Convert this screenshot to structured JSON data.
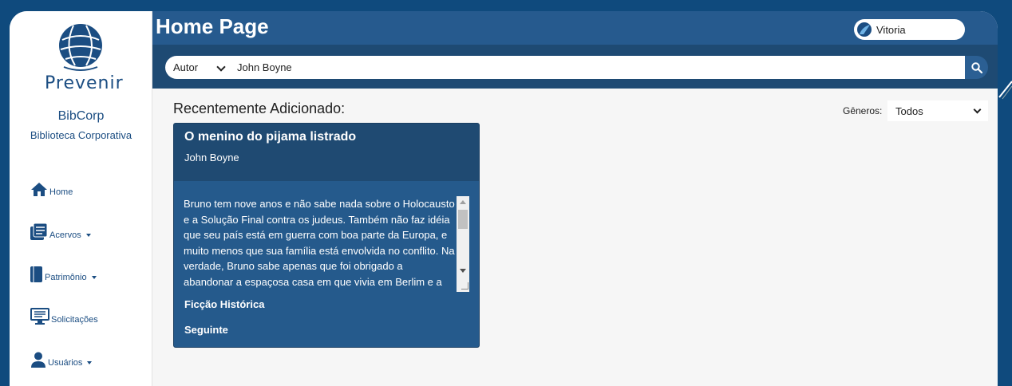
{
  "brand": {
    "logo_text": "Prevenir",
    "org_name": "BibCorp",
    "org_subtitle": "Biblioteca Corporativa"
  },
  "sidebar": {
    "items": [
      {
        "label": "Home",
        "icon": "home-icon",
        "has_caret": false
      },
      {
        "label": "Acervos",
        "icon": "books-icon",
        "has_caret": true
      },
      {
        "label": "Patrimônio",
        "icon": "book-icon",
        "has_caret": true
      },
      {
        "label": "Solicitações",
        "icon": "monitor-icon",
        "has_caret": false
      },
      {
        "label": "Usuários",
        "icon": "user-icon",
        "has_caret": true
      }
    ]
  },
  "header": {
    "title": "Home Page",
    "user_name": "Vitoria"
  },
  "search": {
    "filter_selected": "Autor",
    "query": "John Boyne"
  },
  "main": {
    "section_title": "Recentemente Adicionado:",
    "genre_label": "Gêneros:",
    "genre_selected": "Todos"
  },
  "books": [
    {
      "title": "O menino do pijama listrado",
      "author": "John Boyne",
      "synopsis": "Bruno tem nove anos e não sabe nada sobre o Holocausto e a Solução Final contra os judeus. Também não faz idéia que seu país está em guerra com boa parte da Europa, e muito menos que sua família está envolvida no conflito. Na verdade, Bruno sabe apenas que foi obrigado a abandonar a espaçosa casa em que vivia em Berlim e a mudar-se para uma região desolada onde ele não tem ninguém para brincar nem nada para fazer.",
      "genre": "Ficção Histórica",
      "status": "Seguinte"
    }
  ],
  "colors": {
    "page_bg": "#0f4a7d",
    "header": "#265a8e",
    "search_bar": "#1e4a73",
    "card": "#255a8c",
    "card_head": "#1f4a72",
    "brand": "#1b4d82"
  }
}
